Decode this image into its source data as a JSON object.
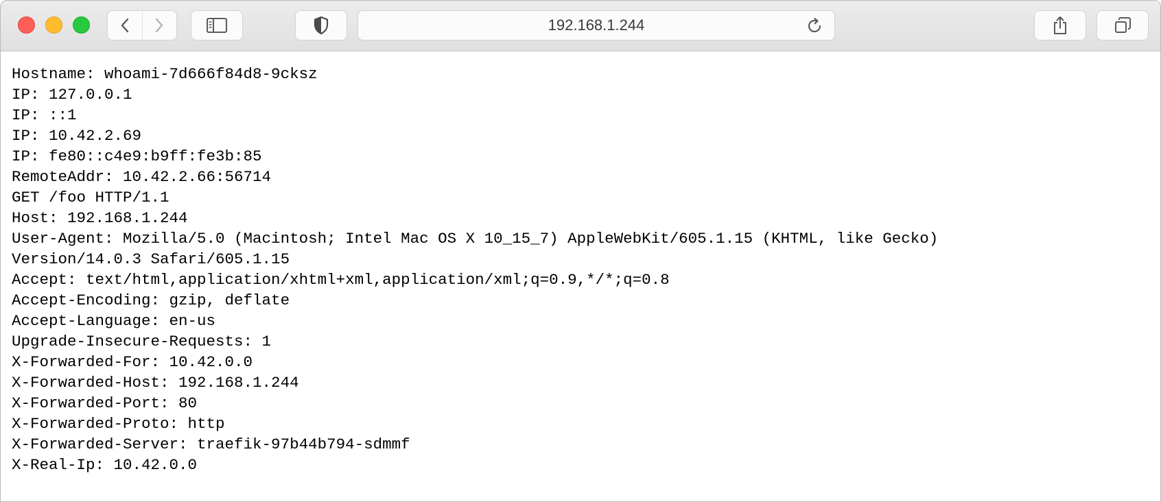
{
  "browser": {
    "address_bar": {
      "url": "192.168.1.244"
    },
    "icons": {
      "back": "chevron-left-icon",
      "forward": "chevron-right-icon",
      "sidebar": "sidebar-icon",
      "privacy": "shield-icon",
      "reload": "reload-icon",
      "share": "share-icon",
      "tabs": "tabs-overview-icon"
    },
    "colors": {
      "close": "#ff5f57",
      "minimize": "#febc2e",
      "zoom": "#28c840"
    }
  },
  "page": {
    "lines": [
      "Hostname: whoami-7d666f84d8-9cksz",
      "IP: 127.0.0.1",
      "IP: ::1",
      "IP: 10.42.2.69",
      "IP: fe80::c4e9:b9ff:fe3b:85",
      "RemoteAddr: 10.42.2.66:56714",
      "GET /foo HTTP/1.1",
      "Host: 192.168.1.244",
      "User-Agent: Mozilla/5.0 (Macintosh; Intel Mac OS X 10_15_7) AppleWebKit/605.1.15 (KHTML, like Gecko)",
      "Version/14.0.3 Safari/605.1.15",
      "Accept: text/html,application/xhtml+xml,application/xml;q=0.9,*/*;q=0.8",
      "Accept-Encoding: gzip, deflate",
      "Accept-Language: en-us",
      "Upgrade-Insecure-Requests: 1",
      "X-Forwarded-For: 10.42.0.0",
      "X-Forwarded-Host: 192.168.1.244",
      "X-Forwarded-Port: 80",
      "X-Forwarded-Proto: http",
      "X-Forwarded-Server: traefik-97b44b794-sdmmf",
      "X-Real-Ip: 10.42.0.0"
    ]
  }
}
